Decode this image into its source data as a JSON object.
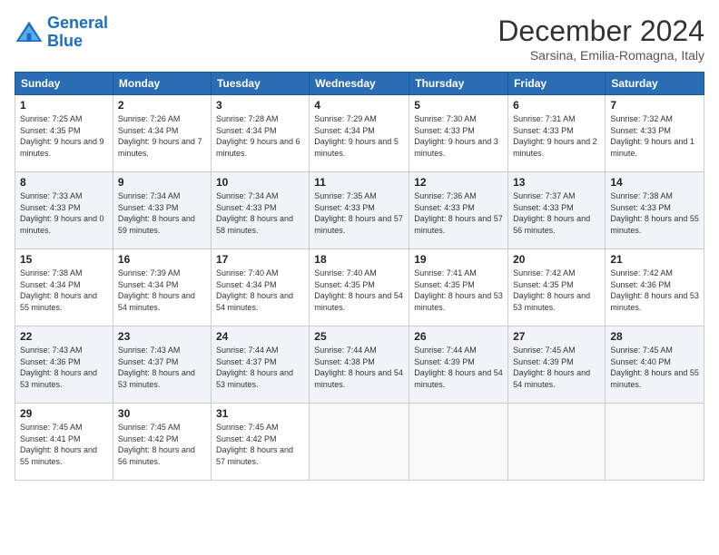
{
  "logo": {
    "line1": "General",
    "line2": "Blue"
  },
  "header": {
    "title": "December 2024",
    "subtitle": "Sarsina, Emilia-Romagna, Italy"
  },
  "weekdays": [
    "Sunday",
    "Monday",
    "Tuesday",
    "Wednesday",
    "Thursday",
    "Friday",
    "Saturday"
  ],
  "weeks": [
    [
      {
        "day": "1",
        "sunrise": "Sunrise: 7:25 AM",
        "sunset": "Sunset: 4:35 PM",
        "daylight": "Daylight: 9 hours and 9 minutes."
      },
      {
        "day": "2",
        "sunrise": "Sunrise: 7:26 AM",
        "sunset": "Sunset: 4:34 PM",
        "daylight": "Daylight: 9 hours and 7 minutes."
      },
      {
        "day": "3",
        "sunrise": "Sunrise: 7:28 AM",
        "sunset": "Sunset: 4:34 PM",
        "daylight": "Daylight: 9 hours and 6 minutes."
      },
      {
        "day": "4",
        "sunrise": "Sunrise: 7:29 AM",
        "sunset": "Sunset: 4:34 PM",
        "daylight": "Daylight: 9 hours and 5 minutes."
      },
      {
        "day": "5",
        "sunrise": "Sunrise: 7:30 AM",
        "sunset": "Sunset: 4:33 PM",
        "daylight": "Daylight: 9 hours and 3 minutes."
      },
      {
        "day": "6",
        "sunrise": "Sunrise: 7:31 AM",
        "sunset": "Sunset: 4:33 PM",
        "daylight": "Daylight: 9 hours and 2 minutes."
      },
      {
        "day": "7",
        "sunrise": "Sunrise: 7:32 AM",
        "sunset": "Sunset: 4:33 PM",
        "daylight": "Daylight: 9 hours and 1 minute."
      }
    ],
    [
      {
        "day": "8",
        "sunrise": "Sunrise: 7:33 AM",
        "sunset": "Sunset: 4:33 PM",
        "daylight": "Daylight: 9 hours and 0 minutes."
      },
      {
        "day": "9",
        "sunrise": "Sunrise: 7:34 AM",
        "sunset": "Sunset: 4:33 PM",
        "daylight": "Daylight: 8 hours and 59 minutes."
      },
      {
        "day": "10",
        "sunrise": "Sunrise: 7:34 AM",
        "sunset": "Sunset: 4:33 PM",
        "daylight": "Daylight: 8 hours and 58 minutes."
      },
      {
        "day": "11",
        "sunrise": "Sunrise: 7:35 AM",
        "sunset": "Sunset: 4:33 PM",
        "daylight": "Daylight: 8 hours and 57 minutes."
      },
      {
        "day": "12",
        "sunrise": "Sunrise: 7:36 AM",
        "sunset": "Sunset: 4:33 PM",
        "daylight": "Daylight: 8 hours and 57 minutes."
      },
      {
        "day": "13",
        "sunrise": "Sunrise: 7:37 AM",
        "sunset": "Sunset: 4:33 PM",
        "daylight": "Daylight: 8 hours and 56 minutes."
      },
      {
        "day": "14",
        "sunrise": "Sunrise: 7:38 AM",
        "sunset": "Sunset: 4:33 PM",
        "daylight": "Daylight: 8 hours and 55 minutes."
      }
    ],
    [
      {
        "day": "15",
        "sunrise": "Sunrise: 7:38 AM",
        "sunset": "Sunset: 4:34 PM",
        "daylight": "Daylight: 8 hours and 55 minutes."
      },
      {
        "day": "16",
        "sunrise": "Sunrise: 7:39 AM",
        "sunset": "Sunset: 4:34 PM",
        "daylight": "Daylight: 8 hours and 54 minutes."
      },
      {
        "day": "17",
        "sunrise": "Sunrise: 7:40 AM",
        "sunset": "Sunset: 4:34 PM",
        "daylight": "Daylight: 8 hours and 54 minutes."
      },
      {
        "day": "18",
        "sunrise": "Sunrise: 7:40 AM",
        "sunset": "Sunset: 4:35 PM",
        "daylight": "Daylight: 8 hours and 54 minutes."
      },
      {
        "day": "19",
        "sunrise": "Sunrise: 7:41 AM",
        "sunset": "Sunset: 4:35 PM",
        "daylight": "Daylight: 8 hours and 53 minutes."
      },
      {
        "day": "20",
        "sunrise": "Sunrise: 7:42 AM",
        "sunset": "Sunset: 4:35 PM",
        "daylight": "Daylight: 8 hours and 53 minutes."
      },
      {
        "day": "21",
        "sunrise": "Sunrise: 7:42 AM",
        "sunset": "Sunset: 4:36 PM",
        "daylight": "Daylight: 8 hours and 53 minutes."
      }
    ],
    [
      {
        "day": "22",
        "sunrise": "Sunrise: 7:43 AM",
        "sunset": "Sunset: 4:36 PM",
        "daylight": "Daylight: 8 hours and 53 minutes."
      },
      {
        "day": "23",
        "sunrise": "Sunrise: 7:43 AM",
        "sunset": "Sunset: 4:37 PM",
        "daylight": "Daylight: 8 hours and 53 minutes."
      },
      {
        "day": "24",
        "sunrise": "Sunrise: 7:44 AM",
        "sunset": "Sunset: 4:37 PM",
        "daylight": "Daylight: 8 hours and 53 minutes."
      },
      {
        "day": "25",
        "sunrise": "Sunrise: 7:44 AM",
        "sunset": "Sunset: 4:38 PM",
        "daylight": "Daylight: 8 hours and 54 minutes."
      },
      {
        "day": "26",
        "sunrise": "Sunrise: 7:44 AM",
        "sunset": "Sunset: 4:39 PM",
        "daylight": "Daylight: 8 hours and 54 minutes."
      },
      {
        "day": "27",
        "sunrise": "Sunrise: 7:45 AM",
        "sunset": "Sunset: 4:39 PM",
        "daylight": "Daylight: 8 hours and 54 minutes."
      },
      {
        "day": "28",
        "sunrise": "Sunrise: 7:45 AM",
        "sunset": "Sunset: 4:40 PM",
        "daylight": "Daylight: 8 hours and 55 minutes."
      }
    ],
    [
      {
        "day": "29",
        "sunrise": "Sunrise: 7:45 AM",
        "sunset": "Sunset: 4:41 PM",
        "daylight": "Daylight: 8 hours and 55 minutes."
      },
      {
        "day": "30",
        "sunrise": "Sunrise: 7:45 AM",
        "sunset": "Sunset: 4:42 PM",
        "daylight": "Daylight: 8 hours and 56 minutes."
      },
      {
        "day": "31",
        "sunrise": "Sunrise: 7:45 AM",
        "sunset": "Sunset: 4:42 PM",
        "daylight": "Daylight: 8 hours and 57 minutes."
      },
      null,
      null,
      null,
      null
    ]
  ]
}
